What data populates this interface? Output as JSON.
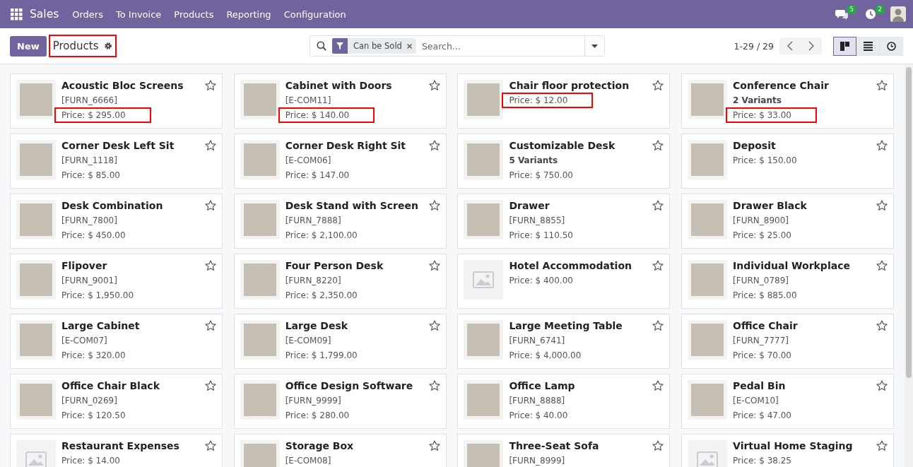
{
  "navbar": {
    "app": "Sales",
    "menu": [
      "Orders",
      "To Invoice",
      "Products",
      "Reporting",
      "Configuration"
    ],
    "messages_badge": "5",
    "activities_badge": "2"
  },
  "control_panel": {
    "new_button": "New",
    "title": "Products",
    "title_highlighted": true,
    "facet": "Can be Sold",
    "search": {
      "placeholder": "Search..."
    },
    "pager": "1-29 / 29",
    "views": [
      {
        "kind": "kanban",
        "selected": true
      },
      {
        "kind": "list",
        "selected": false
      },
      {
        "kind": "activity",
        "selected": false
      }
    ]
  },
  "cards": [
    {
      "name": "Acoustic Bloc Screens",
      "ref": "[FURN_6666]",
      "price": "Price: $ 295.00",
      "kind": "photo",
      "price_highlighted": true
    },
    {
      "name": "Cabinet with Doors",
      "ref": "[E-COM11]",
      "price": "Price: $ 140.00",
      "kind": "photo",
      "price_highlighted": true
    },
    {
      "name": "Chair floor protection",
      "price": "Price: $ 12.00",
      "kind": "photo",
      "price_highlighted": true
    },
    {
      "name": "Conference Chair",
      "variants": "2 Variants",
      "price": "Price: $ 33.00",
      "kind": "photo",
      "price_highlighted": true
    },
    {
      "name": "Corner Desk Left Sit",
      "ref": "[FURN_1118]",
      "price": "Price: $ 85.00",
      "kind": "photo",
      "price_highlighted": false
    },
    {
      "name": "Corner Desk Right Sit",
      "ref": "[E-COM06]",
      "price": "Price: $ 147.00",
      "kind": "photo",
      "price_highlighted": false
    },
    {
      "name": "Customizable Desk",
      "variants": "5 Variants",
      "price": "Price: $ 750.00",
      "kind": "photo",
      "price_highlighted": false
    },
    {
      "name": "Deposit",
      "price": "Price: $ 150.00",
      "kind": "photo",
      "price_highlighted": false
    },
    {
      "name": "Desk Combination",
      "ref": "[FURN_7800]",
      "price": "Price: $ 450.00",
      "kind": "photo",
      "price_highlighted": false
    },
    {
      "name": "Desk Stand with Screen",
      "ref": "[FURN_7888]",
      "price": "Price: $ 2,100.00",
      "kind": "photo",
      "price_highlighted": false
    },
    {
      "name": "Drawer",
      "ref": "[FURN_8855]",
      "price": "Price: $ 110.50",
      "kind": "photo",
      "price_highlighted": false
    },
    {
      "name": "Drawer Black",
      "ref": "[FURN_8900]",
      "price": "Price: $ 25.00",
      "kind": "photo",
      "price_highlighted": false
    },
    {
      "name": "Flipover",
      "ref": "[FURN_9001]",
      "price": "Price: $ 1,950.00",
      "kind": "photo",
      "price_highlighted": false
    },
    {
      "name": "Four Person Desk",
      "ref": "[FURN_8220]",
      "price": "Price: $ 2,350.00",
      "kind": "photo",
      "price_highlighted": false
    },
    {
      "name": "Hotel Accommodation",
      "price": "Price: $ 400.00",
      "kind": "placeholder",
      "price_highlighted": false
    },
    {
      "name": "Individual Workplace",
      "ref": "[FURN_0789]",
      "price": "Price: $ 885.00",
      "kind": "photo",
      "price_highlighted": false
    },
    {
      "name": "Large Cabinet",
      "ref": "[E-COM07]",
      "price": "Price: $ 320.00",
      "kind": "photo",
      "price_highlighted": false
    },
    {
      "name": "Large Desk",
      "ref": "[E-COM09]",
      "price": "Price: $ 1,799.00",
      "kind": "photo",
      "price_highlighted": false
    },
    {
      "name": "Large Meeting Table",
      "ref": "[FURN_6741]",
      "price": "Price: $ 4,000.00",
      "kind": "photo",
      "price_highlighted": false
    },
    {
      "name": "Office Chair",
      "ref": "[FURN_7777]",
      "price": "Price: $ 70.00",
      "kind": "photo",
      "price_highlighted": false
    },
    {
      "name": "Office Chair Black",
      "ref": "[FURN_0269]",
      "price": "Price: $ 120.50",
      "kind": "photo",
      "price_highlighted": false
    },
    {
      "name": "Office Design Software",
      "ref": "[FURN_9999]",
      "price": "Price: $ 280.00",
      "kind": "photo",
      "price_highlighted": false
    },
    {
      "name": "Office Lamp",
      "ref": "[FURN_8888]",
      "price": "Price: $ 40.00",
      "kind": "photo",
      "price_highlighted": false
    },
    {
      "name": "Pedal Bin",
      "ref": "[E-COM10]",
      "price": "Price: $ 47.00",
      "kind": "photo",
      "price_highlighted": false
    },
    {
      "name": "Restaurant Expenses",
      "price": "Price: $ 14.00",
      "kind": "placeholder",
      "price_highlighted": false
    },
    {
      "name": "Storage Box",
      "ref": "[E-COM08]",
      "kind": "photo"
    },
    {
      "name": "Three-Seat Sofa",
      "ref": "[FURN_8999]",
      "kind": "photo"
    },
    {
      "name": "Virtual Home Staging",
      "price": "Price: $ 38.25",
      "kind": "placeholder",
      "price_highlighted": false
    }
  ]
}
